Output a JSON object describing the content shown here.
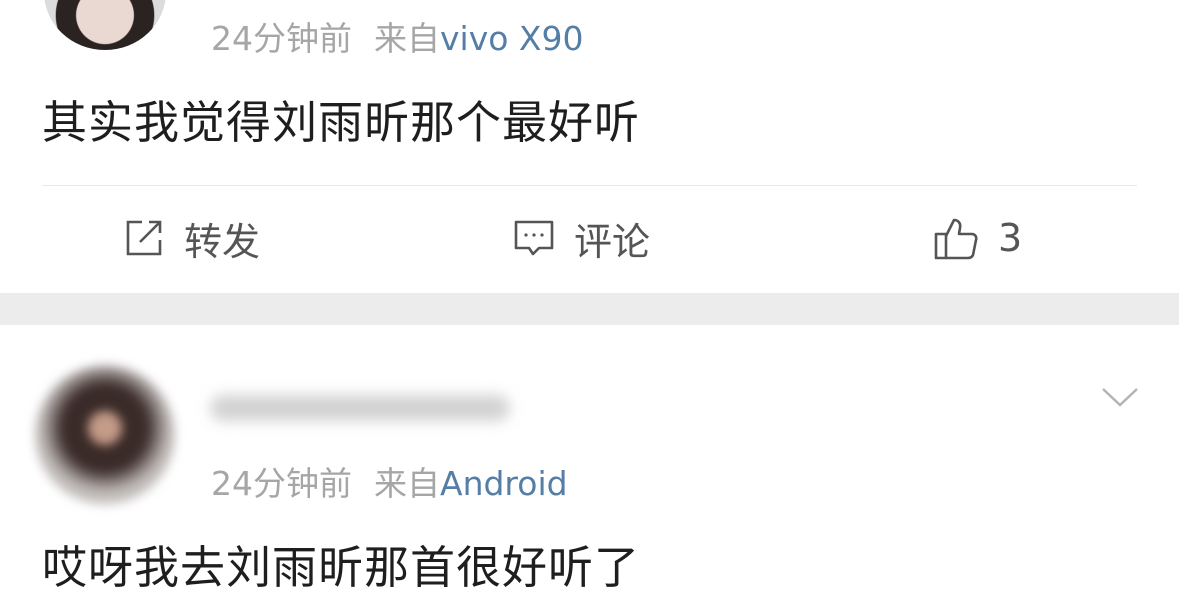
{
  "post1": {
    "time": "24分钟前",
    "from_label": "来自",
    "device": "vivo X90",
    "content": "其实我觉得刘雨昕那个最好听",
    "actions": {
      "repost_label": "转发",
      "comment_label": "评论",
      "like_count": "3"
    }
  },
  "post2": {
    "time": "24分钟前",
    "from_label": "来自",
    "device": "Android",
    "content": "哎呀我去刘雨昕那首很好听了"
  },
  "colors": {
    "meta_text": "#a6a6a6",
    "device_link": "#557ea6",
    "separator_band": "#ececec"
  },
  "icons": [
    "repost-icon",
    "comment-icon",
    "like-icon",
    "chevron-down-icon"
  ]
}
